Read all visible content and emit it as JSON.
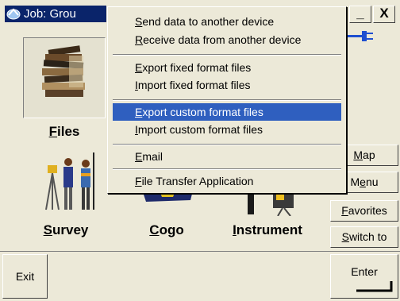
{
  "title": "Job: Grou",
  "window_buttons": {
    "minimize": "_",
    "close": "X"
  },
  "tiles": {
    "files": {
      "accel": "F",
      "rest": "iles"
    },
    "survey": {
      "accel": "S",
      "rest": "urvey"
    },
    "cogo": {
      "accel": "C",
      "rest": "ogo"
    },
    "instrument": {
      "accel": "I",
      "rest": "nstrument"
    }
  },
  "side_buttons": {
    "map": {
      "accel": "M",
      "rest": "ap"
    },
    "menu": {
      "pre": "M",
      "accel": "e",
      "rest": "nu"
    },
    "favorites": {
      "accel": "F",
      "rest": "avorites"
    },
    "switch_to": {
      "accel": "S",
      "rest": "witch to"
    }
  },
  "bottom": {
    "exit": "Exit",
    "enter": "Enter"
  },
  "menu": {
    "items": [
      {
        "accel": "S",
        "rest": "end data to another device"
      },
      {
        "accel": "R",
        "rest": "eceive data from another device"
      },
      {
        "accel": "E",
        "rest": "xport fixed format files"
      },
      {
        "accel": "I",
        "rest": "mport fixed format files"
      },
      {
        "accel": "E",
        "rest": "xport custom format files",
        "selected": true
      },
      {
        "accel": "I",
        "rest": "mport custom format files"
      },
      {
        "accel": "E",
        "rest": "mail"
      },
      {
        "accel": "F",
        "rest": "ile Transfer Application"
      }
    ]
  },
  "colors": {
    "titlebar": "#0a246a",
    "selection": "#2f5fbf",
    "face": "#ece9d8"
  }
}
